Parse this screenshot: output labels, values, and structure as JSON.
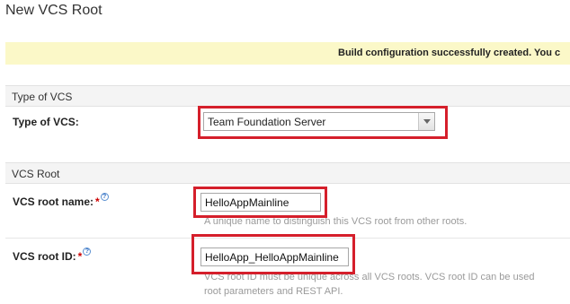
{
  "page": {
    "title": "New VCS Root"
  },
  "banner": {
    "message": "Build configuration successfully created. You c"
  },
  "sections": {
    "type_of_vcs": {
      "header": "Type of VCS"
    },
    "vcs_root": {
      "header": "VCS Root"
    }
  },
  "fields": {
    "type_of_vcs": {
      "label": "Type of VCS:",
      "selected": "Team Foundation Server"
    },
    "vcs_root_name": {
      "label": "VCS root name:",
      "required_mark": "*",
      "help_icon": "help-icon",
      "value": "HelloAppMainline",
      "hint": "A unique name to distinguish this VCS root from other roots."
    },
    "vcs_root_id": {
      "label": "VCS root ID:",
      "required_mark": "*",
      "help_icon": "help-icon",
      "value": "HelloApp_HelloAppMainline",
      "hint_line1": "VCS root ID must be unique across all VCS roots. VCS root ID can be used",
      "hint_line2": "root parameters and REST API."
    }
  },
  "colors": {
    "highlight": "#d51f2b",
    "banner_bg": "#fbf8c8",
    "required": "#cc0000"
  }
}
